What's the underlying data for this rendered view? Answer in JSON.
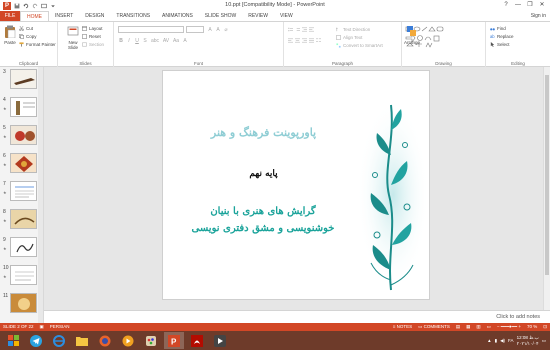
{
  "window": {
    "title": "10.ppt [Compatibility Mode] - PowerPoint",
    "controls": [
      "?",
      "—",
      "❐",
      "✕"
    ]
  },
  "ribbon_tabs": [
    "FILE",
    "HOME",
    "INSERT",
    "DESIGN",
    "TRANSITIONS",
    "ANIMATIONS",
    "SLIDE SHOW",
    "REVIEW",
    "VIEW"
  ],
  "active_tab": "HOME",
  "sign_in": "Sign in",
  "clipboard": {
    "label": "Clipboard",
    "paste": "Paste",
    "cut": "Cut",
    "copy": "Copy",
    "format_painter": "Format Painter"
  },
  "slides_group": {
    "label": "Slides",
    "new_slide": "New Slide",
    "layout": "Layout",
    "reset": "Reset",
    "section": "Section"
  },
  "font_group": {
    "label": "Font",
    "buttons": [
      "B",
      "I",
      "U",
      "S",
      "abc",
      "AV",
      "Aa",
      "A"
    ]
  },
  "paragraph_group": {
    "label": "Paragraph",
    "text_direction": "Text Direction",
    "align_text": "Align Text",
    "convert_smartart": "Convert to SmartArt"
  },
  "drawing_group": {
    "label": "Drawing",
    "arrange": "Arrange",
    "quick_styles": "Quick Styles",
    "shape_fill": "Shape Fill",
    "shape_outline": "Shape Outline",
    "shape_effects": "Shape Effects"
  },
  "editing_group": {
    "label": "Editing",
    "find": "Find",
    "replace": "Replace",
    "select": "Select"
  },
  "thumbnails": [
    "3",
    "4",
    "5",
    "6",
    "7",
    "8",
    "9",
    "10",
    "11"
  ],
  "slide": {
    "title": "پاورپوینت فرهنگ و هنر",
    "grade": "پایه نهم",
    "subtitle_line1": "گرایش های هنری با بنیان",
    "subtitle_line2": "خوشنویسی و مشق دفتری نویسی"
  },
  "notes": {
    "placeholder": "Click to add notes"
  },
  "status": {
    "slide_info": "SLIDE 2 OF 22",
    "language": "PERSIAN",
    "notes": "NOTES",
    "comments": "COMMENTS",
    "zoom": "70 %"
  },
  "taskbar": {
    "time": "12:08 ب.ظ",
    "date": "۲۰۲۱/۱۰/۰۴",
    "language": "FA"
  },
  "colors": {
    "accent": "#d24726",
    "taskbar": "#6e3b2a",
    "slide_title": "#8ecdd4",
    "slide_subtitle": "#1aa39a"
  }
}
